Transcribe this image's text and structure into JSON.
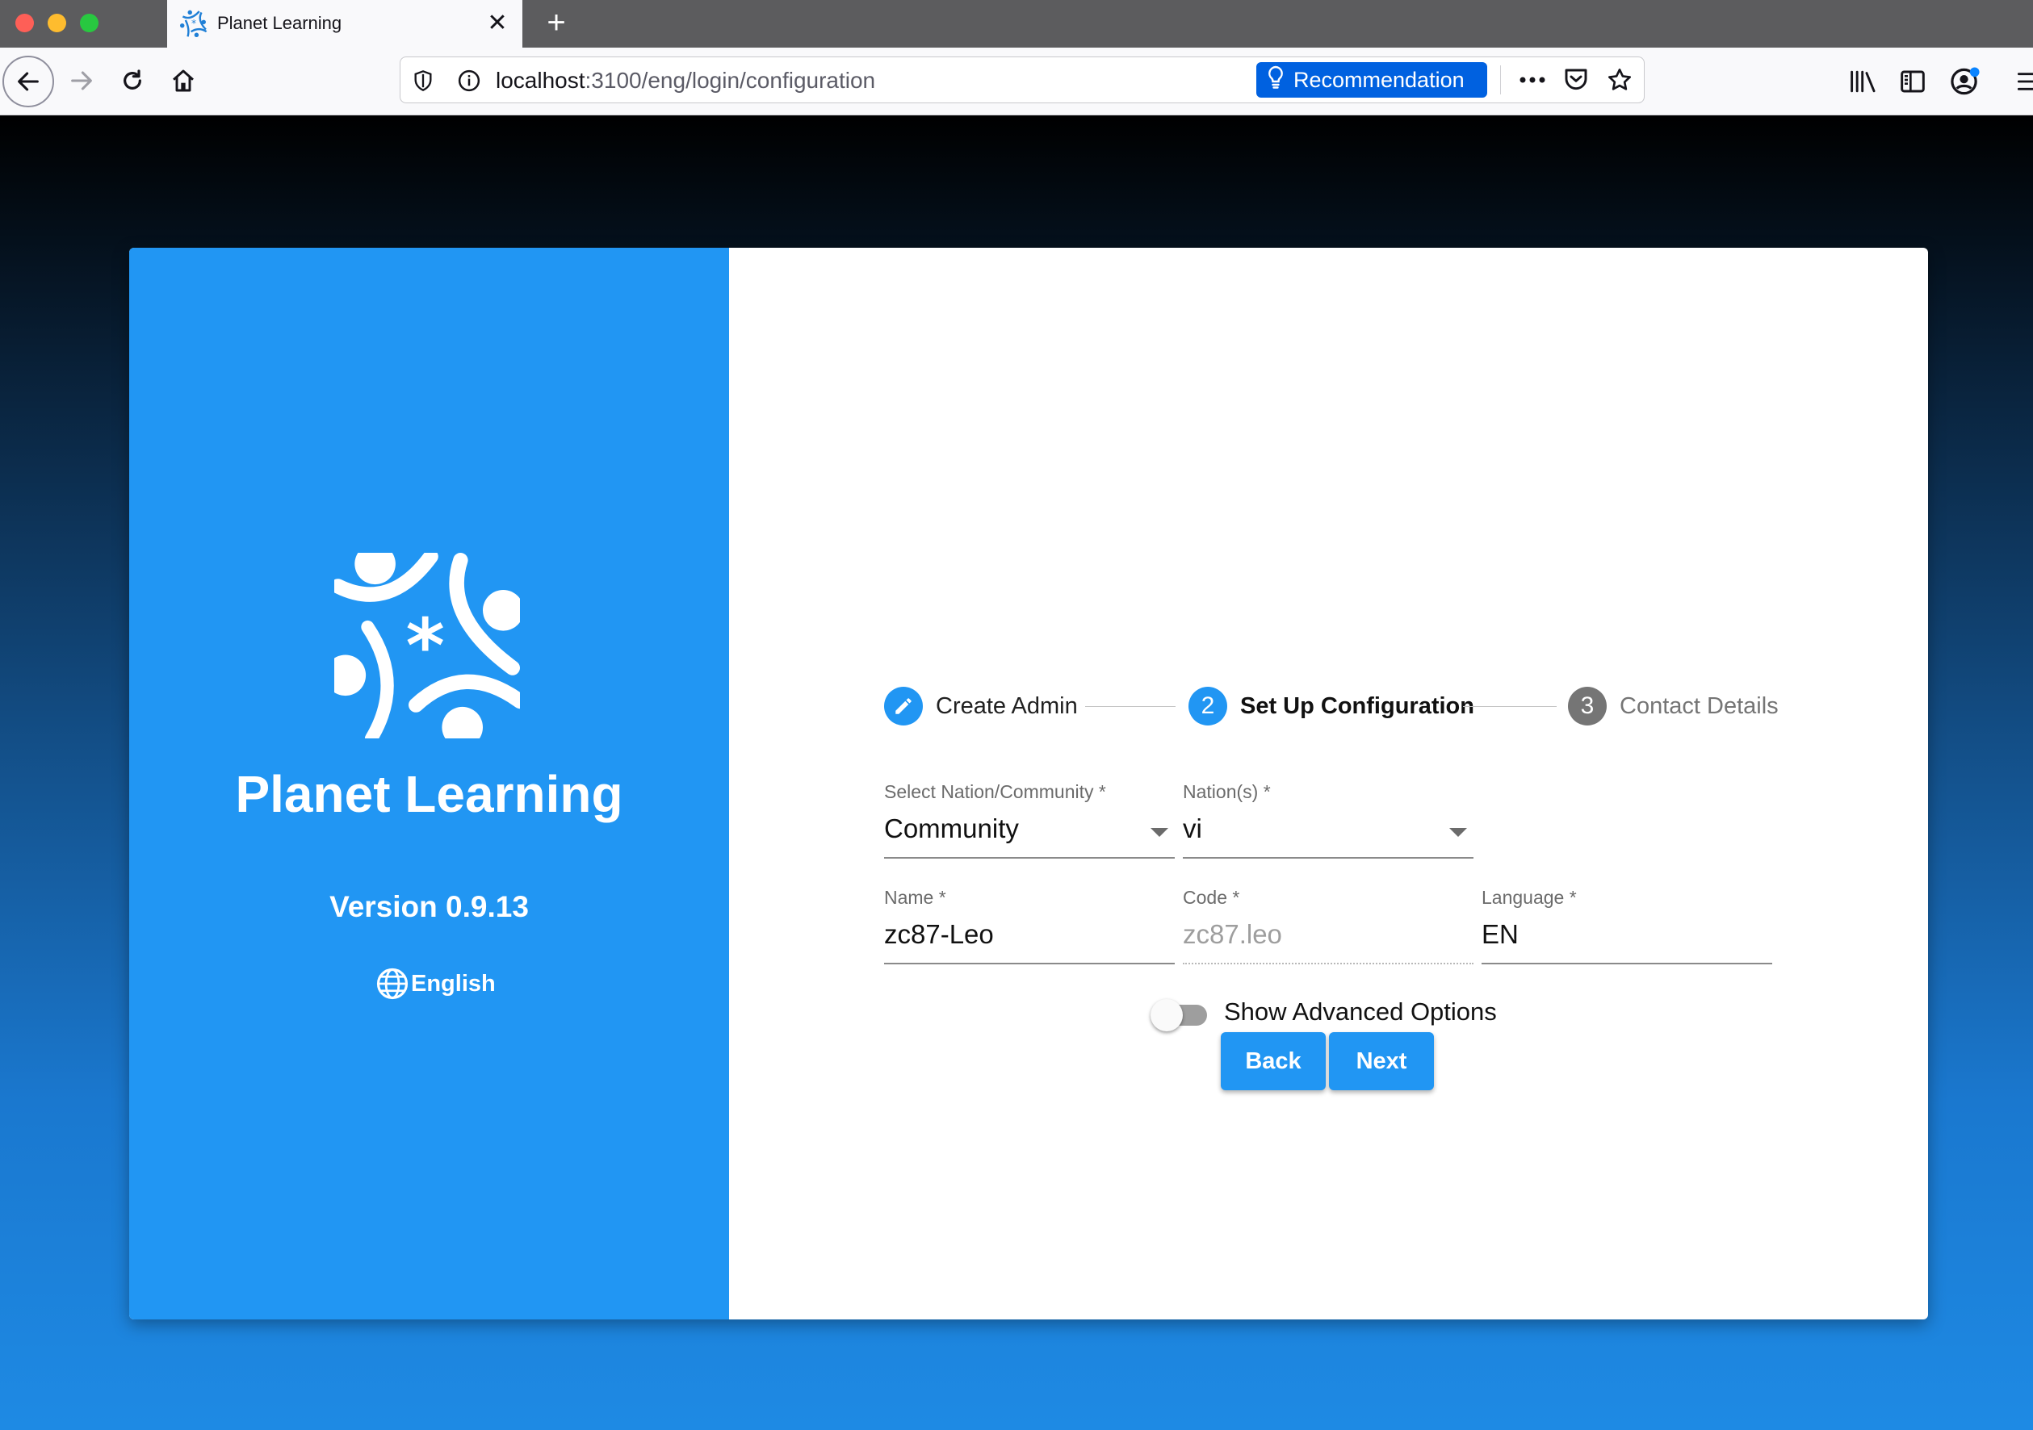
{
  "browser": {
    "tab_title": "Planet Learning",
    "url_host": "localhost",
    "url_path": ":3100/eng/login/configuration",
    "recommendation_label": "Recommendation",
    "new_tab_glyph": "+",
    "close_glyph": "✕",
    "icons": [
      "back-arrow-icon",
      "forward-arrow-icon",
      "reload-icon",
      "home-icon",
      "shield-icon",
      "info-icon",
      "lightbulb-icon",
      "more-icon",
      "pocket-icon",
      "star-icon",
      "library-icon",
      "sidebar-icon",
      "account-icon",
      "menu-icon"
    ]
  },
  "brand": {
    "title": "Planet Learning",
    "version": "Version 0.9.13",
    "language": "English"
  },
  "stepper": {
    "steps": [
      {
        "number": "",
        "label": "Create Admin",
        "state": "done"
      },
      {
        "number": "2",
        "label": "Set Up Configuration",
        "state": "active"
      },
      {
        "number": "3",
        "label": "Contact Details",
        "state": "pending"
      }
    ]
  },
  "form": {
    "nation_community": {
      "label": "Select Nation/Community *",
      "value": "Community"
    },
    "nations": {
      "label": "Nation(s) *",
      "value": "vi"
    },
    "name": {
      "label": "Name *",
      "value": "zc87-Leo"
    },
    "code": {
      "label": "Code *",
      "value": "zc87.leo"
    },
    "language": {
      "label": "Language *",
      "value": "EN"
    },
    "advanced_toggle_label": "Show Advanced Options",
    "back_label": "Back",
    "next_label": "Next"
  },
  "colors": {
    "primary": "#2196f3",
    "firefox_blue": "#0061e0",
    "step_pending": "#757575"
  }
}
